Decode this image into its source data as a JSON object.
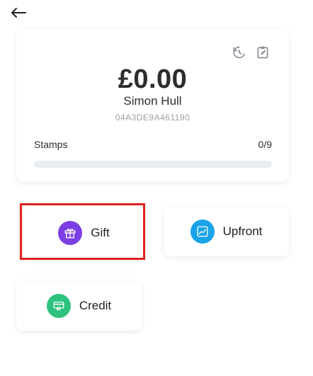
{
  "header": {
    "back_icon": "arrow-left-icon"
  },
  "card": {
    "balance": "£0.00",
    "name": "Simon Hull",
    "card_id": "04A3DE9A461190",
    "icons": [
      "history-icon",
      "edit-clipboard-icon"
    ],
    "stamps_label": "Stamps",
    "stamps_count": "0/9",
    "stamps_progress": 0
  },
  "actions": {
    "gift": {
      "label": "Gift",
      "icon": "gift-icon",
      "color": "#7b3fe4"
    },
    "upfront": {
      "label": "Upfront",
      "icon": "chart-up-icon",
      "color": "#1aa3e8"
    },
    "credit": {
      "label": "Credit",
      "icon": "credit-card-icon",
      "color": "#2ec27e"
    }
  },
  "highlight_color": "#e02020"
}
